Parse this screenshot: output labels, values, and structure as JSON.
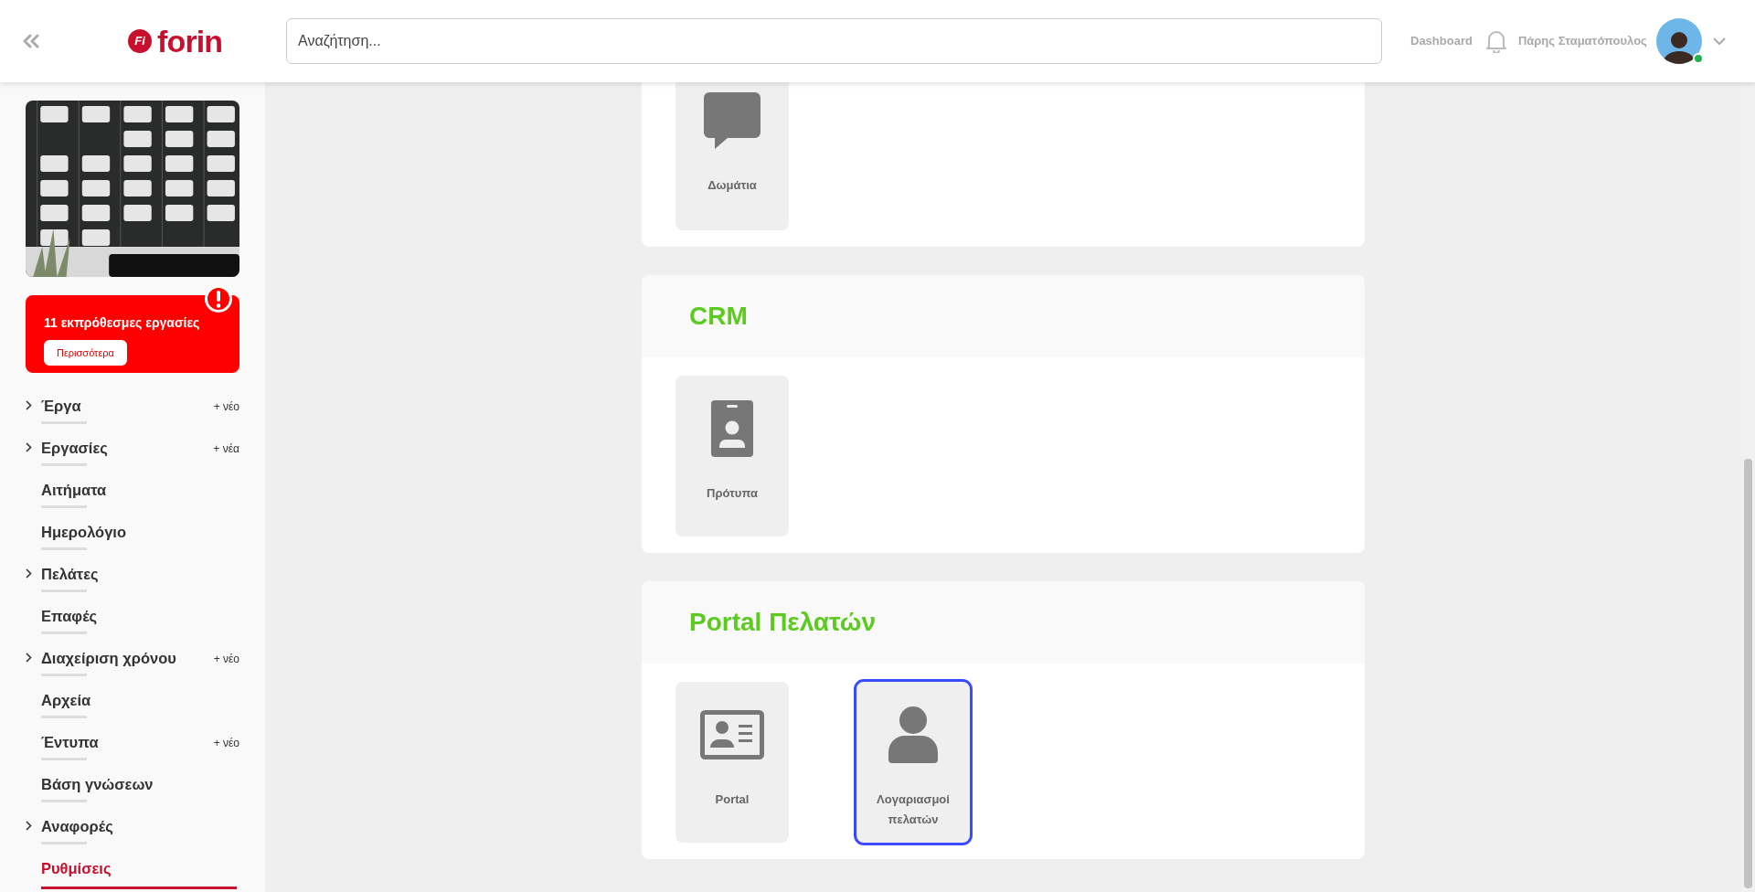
{
  "header": {
    "logo_mark": "Fi",
    "logo_text": "forin",
    "search": {
      "placeholder": "Αναζήτηση..."
    },
    "dashboard_link": "Dashboard",
    "user": {
      "name": "Πάρης Σταματόπουλος",
      "online": true
    }
  },
  "sidebar": {
    "alert": {
      "text": "11 εκπρόθεσμες εργασίες",
      "button": "Περισσότερα"
    },
    "items": [
      {
        "label": "Έργα",
        "expandable": true,
        "new_label": "+ νέο",
        "selected": false
      },
      {
        "label": "Εργασίες",
        "expandable": true,
        "new_label": "+ νέα",
        "selected": false
      },
      {
        "label": "Αιτήματα",
        "expandable": false,
        "selected": false
      },
      {
        "label": "Ημερολόγιο",
        "expandable": false,
        "selected": false
      },
      {
        "label": "Πελάτες",
        "expandable": true,
        "selected": false
      },
      {
        "label": "Επαφές",
        "expandable": false,
        "selected": false
      },
      {
        "label": "Διαχείριση χρόνου",
        "expandable": true,
        "new_label": "+ νέο",
        "selected": false
      },
      {
        "label": "Αρχεία",
        "expandable": false,
        "selected": false
      },
      {
        "label": "Έντυπα",
        "expandable": false,
        "new_label": "+ νέο",
        "selected": false
      },
      {
        "label": "Βάση γνώσεων",
        "expandable": false,
        "selected": false
      },
      {
        "label": "Αναφορές",
        "expandable": true,
        "selected": false
      },
      {
        "label": "Ρυθμίσεις",
        "expandable": false,
        "selected": true
      }
    ]
  },
  "sections": [
    {
      "tiles": [
        {
          "kind": "chat",
          "label": "Δωμάτια",
          "selected": false
        }
      ]
    },
    {
      "title": "CRM",
      "tiles": [
        {
          "kind": "badge",
          "label": "Πρότυπα",
          "selected": false
        }
      ]
    },
    {
      "title": "Portal Πελατών",
      "tiles": [
        {
          "kind": "contact-card",
          "label": "Portal",
          "selected": false
        },
        {
          "kind": "person",
          "label": "Λογαριασμοί πελατών",
          "selected": true
        }
      ]
    }
  ]
}
